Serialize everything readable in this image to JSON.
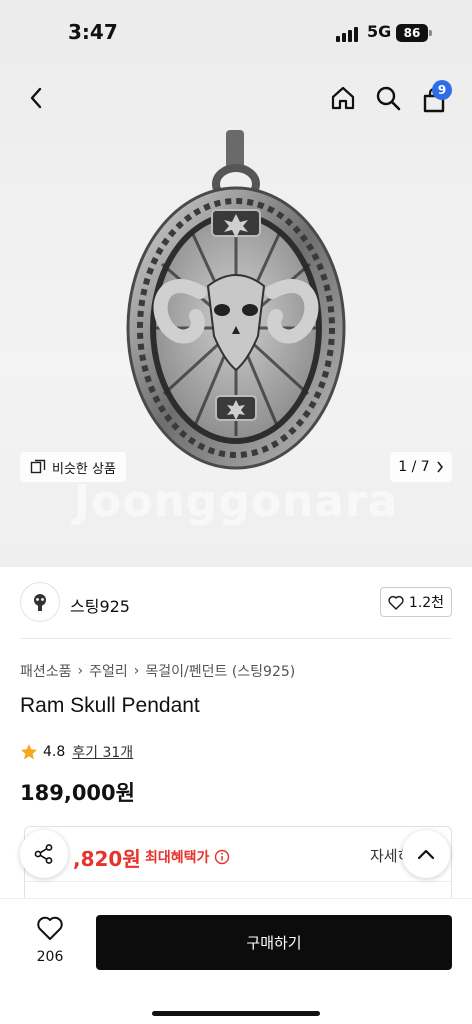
{
  "status_bar": {
    "time": "3:47",
    "network": "5G",
    "battery": "86"
  },
  "header": {
    "back_icon": "chevron-left-icon",
    "home_icon": "home-icon",
    "search_icon": "search-icon",
    "cart_icon": "bag-icon",
    "cart_count": "9"
  },
  "gallery": {
    "watermark": "Joonggonara",
    "similar_label": "비슷한 상품",
    "pager": "1 / 7"
  },
  "shop": {
    "name": "스팅925",
    "likes": "1.2천"
  },
  "breadcrumb": [
    "패션소품",
    "주얼리",
    "목걸이/펜던트 (스팅925)"
  ],
  "product": {
    "title": "Ram Skull Pendant",
    "rating": "4.8",
    "review_link": "후기 31개",
    "price": "189,000원"
  },
  "benefit": {
    "amount": ",820원",
    "label": "최대혜택가",
    "detail": "자세히"
  },
  "bottom_bar": {
    "wish_count": "206",
    "buy_label": "구매하기"
  },
  "colors": {
    "accent_blue": "#2f6de8",
    "benefit_red": "#e8322c",
    "buy_button": "#0c0c0c",
    "star": "#f5a623"
  }
}
